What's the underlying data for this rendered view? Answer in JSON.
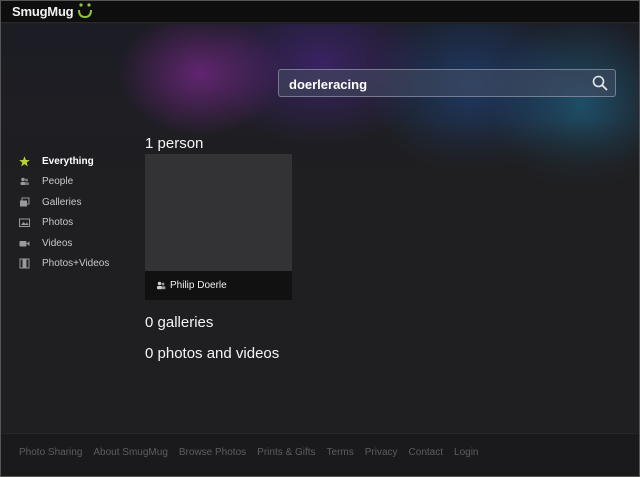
{
  "header": {
    "logo_text": "SmugMug"
  },
  "search": {
    "query": "doerleracing"
  },
  "sidebar": {
    "items": [
      {
        "label": "Everything",
        "icon": "star-icon",
        "active": true
      },
      {
        "label": "People",
        "icon": "people-icon",
        "active": false
      },
      {
        "label": "Galleries",
        "icon": "galleries-icon",
        "active": false
      },
      {
        "label": "Photos",
        "icon": "photo-icon",
        "active": false
      },
      {
        "label": "Videos",
        "icon": "video-camera-icon",
        "active": false
      },
      {
        "label": "Photos+Videos",
        "icon": "film-icon",
        "active": false
      }
    ]
  },
  "results": {
    "people_heading": "1 person",
    "person_name": "Philip Doerle",
    "galleries_heading": "0 galleries",
    "media_heading": "0 photos and videos"
  },
  "footer": {
    "links": [
      "Photo Sharing",
      "About SmugMug",
      "Browse Photos",
      "Prints & Gifts",
      "Terms",
      "Privacy",
      "Contact",
      "Login"
    ]
  },
  "colors": {
    "accent_star": "#b8d430",
    "background": "#1f1f22",
    "footer_text": "#5d5d62"
  }
}
